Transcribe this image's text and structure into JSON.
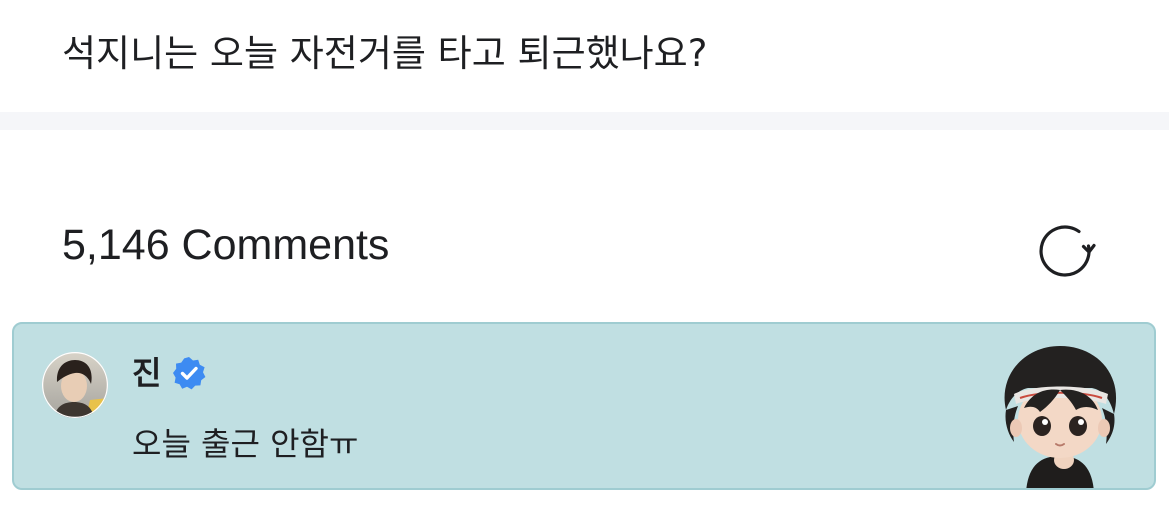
{
  "post": {
    "question": "석지니는 오늘 자전거를 타고 퇴근했나요?"
  },
  "comments": {
    "count_label": "5,146 Comments",
    "refresh_icon": "refresh-icon"
  },
  "highlighted_comment": {
    "author": "진",
    "verified_icon": "verified-badge-icon",
    "text": "오늘 출근 안함ㅠ",
    "avatar_icon": "avatar",
    "sticker_icon": "chibi-character-sticker"
  },
  "colors": {
    "card_background": "#c0dfe2",
    "card_border": "#9fccd1",
    "verified_blue": "#3d8bf2",
    "text": "#1e1f22"
  }
}
